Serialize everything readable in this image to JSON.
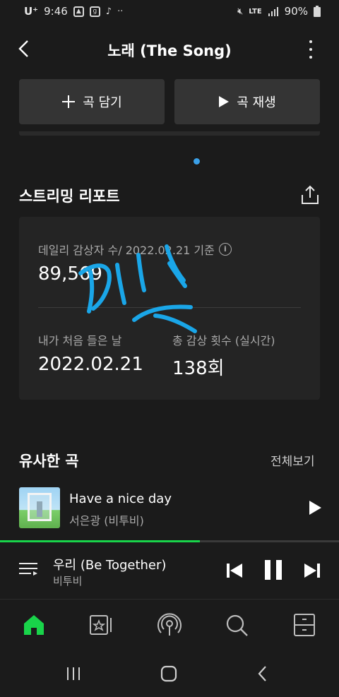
{
  "status_bar": {
    "carrier": "U⁺",
    "time": "9:46",
    "network": "LTE",
    "battery": "90%"
  },
  "header": {
    "title": "노래 (The Song)"
  },
  "actions": {
    "add_label": "곡 담기",
    "play_label": "곡 재생"
  },
  "report": {
    "title": "스트리밍 리포트",
    "daily_label": "데일리 감상자 수/ 2022.02.21 기준",
    "daily_value": "89,569",
    "first_listen_label": "내가 처음 들은 날",
    "first_listen_value": "2022.02.21",
    "total_plays_label": "총 감상 횟수 (실시간)",
    "total_plays_value": "138회"
  },
  "similar": {
    "title": "유사한 곡",
    "view_all": "전체보기",
    "songs": [
      {
        "title": "Have a nice day",
        "artist": "서은광 (비투비)"
      }
    ]
  },
  "player": {
    "title": "우리 (Be Together)",
    "artist": "비투비",
    "progress_percent": 59
  },
  "colors": {
    "accent": "#19d44a",
    "annotation": "#1aa6e8",
    "background": "#1b1b1b",
    "card": "#242424"
  }
}
